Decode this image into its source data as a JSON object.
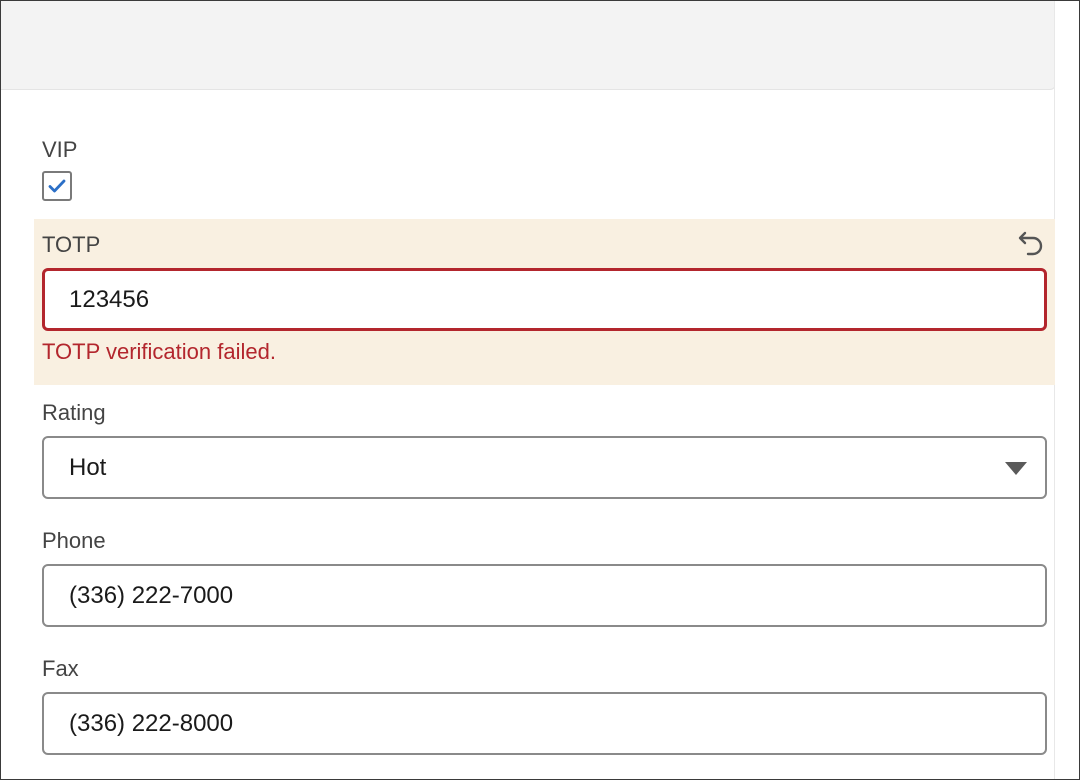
{
  "form": {
    "vip": {
      "label": "VIP",
      "checked": true
    },
    "totp": {
      "label": "TOTP",
      "value": "123456",
      "error": "TOTP verification failed.",
      "reset_icon": "undo-icon"
    },
    "rating": {
      "label": "Rating",
      "value": "Hot",
      "icon": "chevron-down-icon"
    },
    "phone": {
      "label": "Phone",
      "value": "(336) 222-7000"
    },
    "fax": {
      "label": "Fax",
      "value": "(336) 222-8000"
    }
  },
  "colors": {
    "error": "#b3262d",
    "highlight_bg": "#f9f0e1",
    "checkmark": "#2b6fc7",
    "header_bg": "#f3f3f3"
  }
}
